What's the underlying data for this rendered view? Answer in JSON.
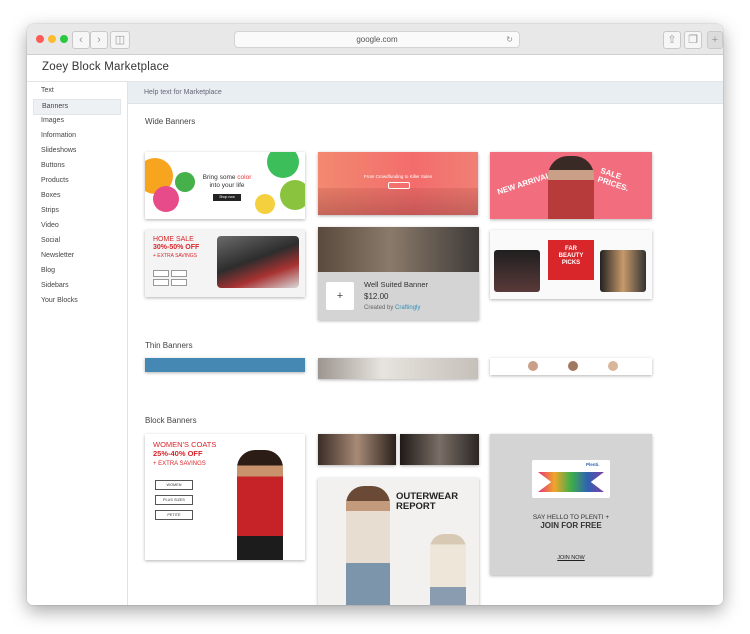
{
  "browser": {
    "url": "google.com"
  },
  "app": {
    "title": "Zoey Block Marketplace",
    "help_text": "Help text for Marketplace"
  },
  "sidebar": {
    "items": [
      {
        "label": "Text"
      },
      {
        "label": "Banners"
      },
      {
        "label": "Images"
      },
      {
        "label": "Information"
      },
      {
        "label": "Slideshows"
      },
      {
        "label": "Buttons"
      },
      {
        "label": "Products"
      },
      {
        "label": "Boxes"
      },
      {
        "label": "Strips"
      },
      {
        "label": "Video"
      },
      {
        "label": "Social"
      },
      {
        "label": "Newsletter"
      },
      {
        "label": "Blog"
      },
      {
        "label": "Sidebars"
      },
      {
        "label": "Your Blocks"
      }
    ],
    "active_index": 1
  },
  "sections": {
    "wide": "Wide Banners",
    "thin": "Thin Banners",
    "block": "Block Banners"
  },
  "cards": {
    "watch": {
      "line1": "Bring some",
      "accent": "color",
      "line2": "into your life",
      "button": "Shop now"
    },
    "crowd": {
      "text": "From Crowdfunding to Killer Sales"
    },
    "arrivals": {
      "left": "NEW ARRIVALS.",
      "right": "SALE PRICES."
    },
    "homesale": {
      "l1": "HOME SALE",
      "l2": "30%-50% OFF",
      "l3": "+ EXTRA SAVINGS"
    },
    "suited": {
      "name": "Well Suited Banner",
      "price": "$12.00",
      "by": "Created by",
      "author": "Craftingly",
      "add": "+"
    },
    "beauty": {
      "l1": "FAR",
      "l2": "BEAUTY",
      "l3": "PICKS"
    },
    "coats": {
      "l1": "WOMEN'S COATS",
      "l2": "25%-40% OFF",
      "l3": "+ EXTRA SAVINGS",
      "b1": "WOMEN",
      "b2": "PLUS SIZES",
      "b3": "PETITE"
    },
    "outerwear": {
      "l1": "OUTERWEAR",
      "l2": "REPORT"
    },
    "plenti": {
      "logo": "Plenti.",
      "l1": "SAY HELLO TO PLENTI +",
      "l2": "JOIN FOR FREE",
      "link": "JOIN NOW"
    }
  },
  "colors": {
    "accent": "#2f8fb8",
    "red": "#d8262b",
    "coral": "#f08075",
    "pink": "#f26d7d",
    "card_gray": "#d4d4d4"
  }
}
